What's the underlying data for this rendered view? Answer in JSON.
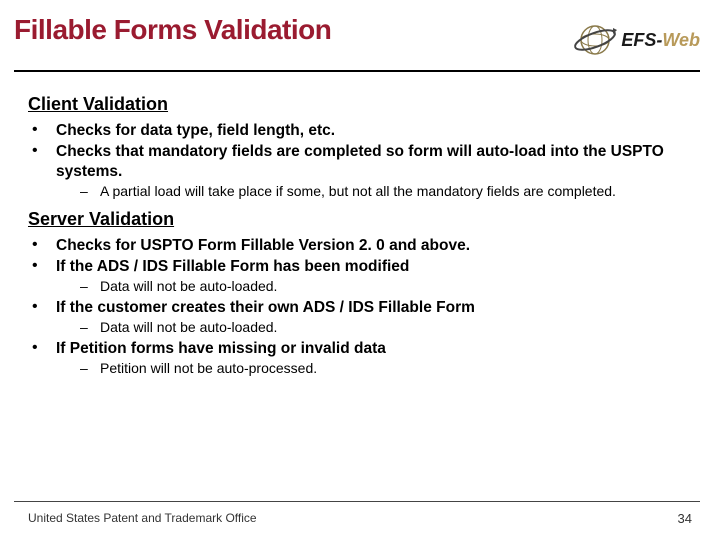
{
  "header": {
    "title": "Fillable Forms Validation",
    "logo_text_prefix": "EFS-",
    "logo_text_suffix": "Web"
  },
  "sections": [
    {
      "heading": "Client Validation",
      "items": [
        {
          "text": "Checks for data type, field length, etc.",
          "sub": []
        },
        {
          "text": "Checks that mandatory fields are completed so form will auto-load into the USPTO systems.",
          "sub": [
            "A partial load will take place if some, but not all the mandatory fields are completed."
          ]
        }
      ]
    },
    {
      "heading": "Server Validation",
      "items": [
        {
          "text": "Checks for USPTO Form Fillable Version 2. 0 and above.",
          "sub": []
        },
        {
          "text": "If the ADS / IDS Fillable Form has been modified",
          "sub": [
            "Data will not be auto-loaded."
          ]
        },
        {
          "text": "If the customer creates their own ADS / IDS Fillable Form",
          "sub": [
            "Data will not be auto-loaded."
          ]
        },
        {
          "text": "If Petition forms have missing or invalid data",
          "sub": [
            "Petition will not be auto-processed."
          ]
        }
      ]
    }
  ],
  "footer": {
    "org": "United States Patent and Trademark Office",
    "page": "34"
  }
}
